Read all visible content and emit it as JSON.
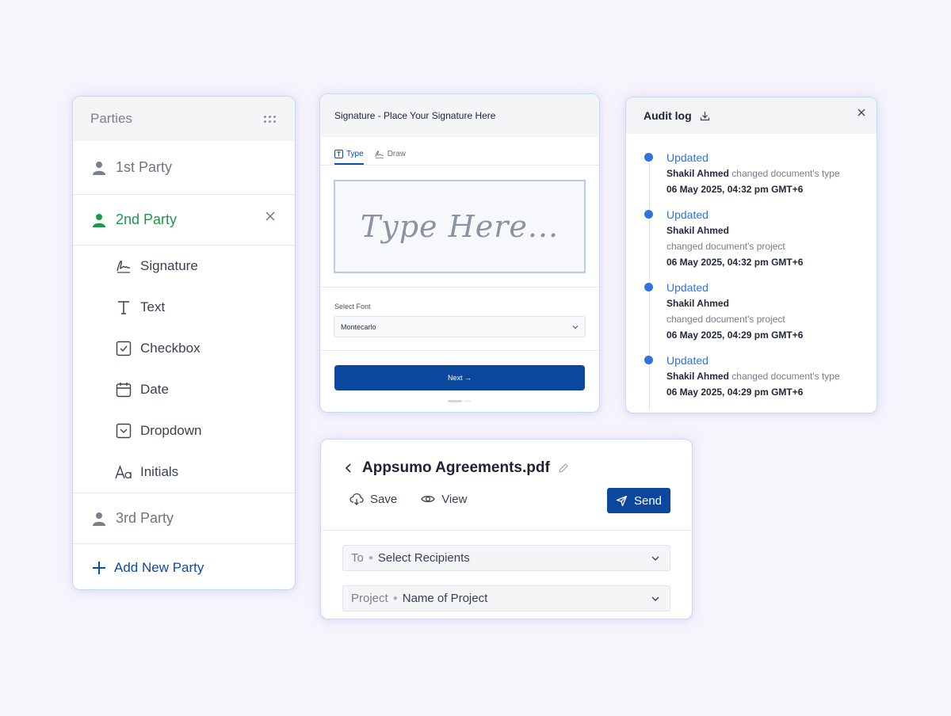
{
  "parties_panel": {
    "title": "Parties",
    "parties": [
      {
        "label": "1st Party"
      },
      {
        "label": "2nd Party"
      },
      {
        "label": "3rd Party"
      }
    ],
    "fields": [
      {
        "label": "Signature",
        "icon": "signature-icon"
      },
      {
        "label": "Text",
        "icon": "text-icon"
      },
      {
        "label": "Checkbox",
        "icon": "checkbox-icon"
      },
      {
        "label": "Date",
        "icon": "calendar-icon"
      },
      {
        "label": "Dropdown",
        "icon": "dropdown-icon"
      },
      {
        "label": "Initials",
        "icon": "initials-icon"
      }
    ],
    "add_label": "Add New Party",
    "colors": {
      "active": "#1a9a46",
      "link": "#0f4aa3"
    }
  },
  "signature_panel": {
    "title": "Signature - Place Your Signature Here",
    "tabs": [
      {
        "label": "Type"
      },
      {
        "label": "Draw"
      }
    ],
    "placeholder": "Type Here...",
    "font_label": "Select Font",
    "font_value": "Montecarlo",
    "next_label": "Next →"
  },
  "audit_log": {
    "title": "Audit log",
    "entries": [
      {
        "status": "Updated",
        "user": "Shakil Ahmed",
        "action": "changed document's type",
        "date": "06 May 2025, 04:32 pm GMT+6"
      },
      {
        "status": "Updated",
        "user": "Shakil Ahmed",
        "action": "changed document's project",
        "date": "06 May 2025, 04:32 pm GMT+6"
      },
      {
        "status": "Updated",
        "user": "Shakil Ahmed",
        "action": "changed document's project",
        "date": "06 May 2025, 04:29 pm GMT+6"
      },
      {
        "status": "Updated",
        "user": "Shakil Ahmed",
        "action": "changed document's type",
        "date": "06 May 2025, 04:29 pm GMT+6"
      }
    ],
    "colors": {
      "status": "#2f73e0"
    }
  },
  "document_panel": {
    "title": "Appsumo Agreements.pdf",
    "save_label": "Save",
    "view_label": "View",
    "send_label": "Send",
    "to_prefix": "To",
    "to_value": "Select Recipients",
    "project_prefix": "Project",
    "project_value": "Name of Project",
    "colors": {
      "primary": "#0c479e"
    }
  }
}
